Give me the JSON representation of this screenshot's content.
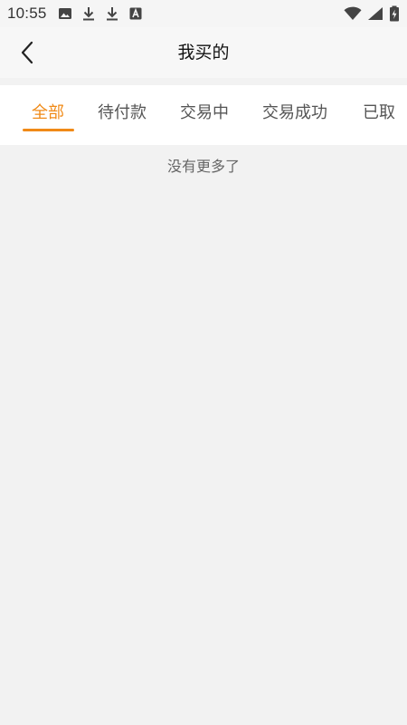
{
  "status_bar": {
    "time": "10:55",
    "icons_left": [
      "image-icon",
      "download-icon",
      "download-icon",
      "font-icon"
    ],
    "icons_right": [
      "wifi-icon",
      "signal-icon",
      "battery-charging-icon"
    ]
  },
  "header": {
    "title": "我买的",
    "back_icon": "chevron-left-icon"
  },
  "tabs": {
    "items": [
      {
        "label": "全部",
        "active": true
      },
      {
        "label": "待付款",
        "active": false
      },
      {
        "label": "交易中",
        "active": false
      },
      {
        "label": "交易成功",
        "active": false
      },
      {
        "label": "已取",
        "active": false
      }
    ],
    "active_color": "#f08a17",
    "inactive_color": "#555555"
  },
  "content": {
    "no_more_text": "没有更多了"
  },
  "colors": {
    "page_background": "#f2f2f2",
    "tab_bar_background": "#ffffff",
    "header_background": "#f7f7f7"
  }
}
